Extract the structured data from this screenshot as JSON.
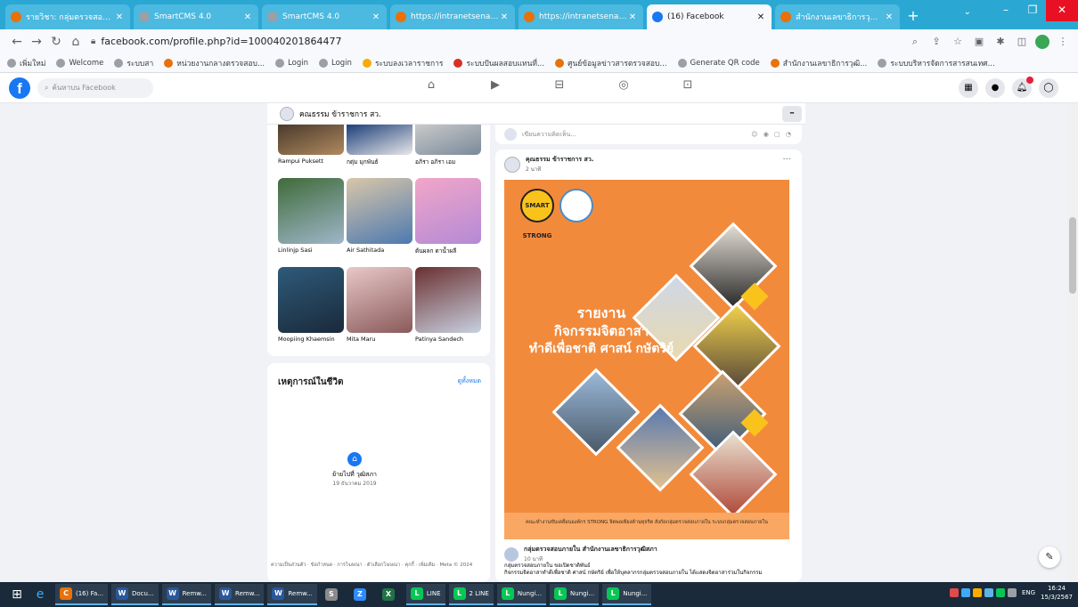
{
  "browser": {
    "tabs": [
      {
        "title": "รายวิชา: กลุ่มตรวจสอบภายใน",
        "color": "#e8710a",
        "active": false
      },
      {
        "title": "SmartCMS 4.0",
        "color": "#9aa0a6",
        "active": false
      },
      {
        "title": "SmartCMS 4.0",
        "color": "#9aa0a6",
        "active": false
      },
      {
        "title": "https://intranetsenate...",
        "color": "#e8710a",
        "active": false
      },
      {
        "title": "https://intranetsenate...",
        "color": "#e8710a",
        "active": false
      },
      {
        "title": "(16) Facebook",
        "color": "#1877f2",
        "active": true
      },
      {
        "title": "สำนักงานเลขาธิการวุฒิสภา",
        "color": "#e8710a",
        "active": false
      }
    ],
    "new_tab": "+",
    "url": "facebook.com/profile.php?id=100040201864477",
    "bookmarks": [
      {
        "label": "เพิ่มใหม่",
        "color": "#9aa0a6"
      },
      {
        "label": "Welcome",
        "color": "#9aa0a6"
      },
      {
        "label": "ระบบสา",
        "color": "#9aa0a6"
      },
      {
        "label": "หน่วยงานกลางตรวจสอบ...",
        "color": "#e8710a"
      },
      {
        "label": "Login",
        "color": "#9aa0a6"
      },
      {
        "label": "Login",
        "color": "#9aa0a6"
      },
      {
        "label": "ระบบลงเวลาราชการ",
        "color": "#f9ab00"
      },
      {
        "label": "ระบบปันผลสอบแทนที่...",
        "color": "#d93025"
      },
      {
        "label": "ศูนย์ข้อมูลข่าวสารตรวจสอบ...",
        "color": "#e8710a"
      },
      {
        "label": "Generate QR code",
        "color": "#9aa0a6"
      },
      {
        "label": "สำนักงานเลขาธิการวุฒิ...",
        "color": "#e8710a"
      },
      {
        "label": "ระบบบริหารจัดการสารสนเทศ...",
        "color": "#9aa0a6"
      }
    ]
  },
  "facebook": {
    "search_placeholder": "ค้นหาบน Facebook",
    "profile_name": "คณธรรม ข้าราชการ สว.",
    "friends": [
      {
        "name": "Rampui Puksett",
        "c1": "#4a3a2a",
        "c2": "#b08a60"
      },
      {
        "name": "กตุ่ม มุกพันธ์",
        "c1": "#1d3f7a",
        "c2": "#e8e8e8"
      },
      {
        "name": "อภิรา อภิรา เอม",
        "c1": "#c9c9c9",
        "c2": "#7a8a9a"
      },
      {
        "name": "Linlinjp Sasi",
        "c1": "#3f6b3a",
        "c2": "#9fb6c9"
      },
      {
        "name": "Air Sathitada",
        "c1": "#d9c6a9",
        "c2": "#4c7ab0"
      },
      {
        "name": "ต้นผลก ดาน้ำผลี",
        "c1": "#f2a6c8",
        "c2": "#b48ad6"
      },
      {
        "name": "Moopiing Khaemsin",
        "c1": "#2e5a7a",
        "c2": "#1a2a3a"
      },
      {
        "name": "Mita Maru",
        "c1": "#e9c8c8",
        "c2": "#8a5a5a"
      },
      {
        "name": "Patinya Sandech",
        "c1": "#6a3030",
        "c2": "#c8d0e0"
      }
    ],
    "events": {
      "title": "เหตุการณ์ในชีวิต",
      "see_all": "ดูทั้งหมด",
      "item_name": "ย้ายไปที่ วุฒิสภา",
      "item_date": "19 ธันวาคม 2019"
    },
    "footer": "ความเป็นส่วนตัว · ข้อกำหนด · การโฆษณา · ตัวเลือกโฆษณา · คุกกี้ · เพิ่มเติม · Meta © 2024",
    "comment_placeholder": "เขียนความคิดเห็น...",
    "post": {
      "author": "คุณธรรม ข้าราชการ สว.",
      "time": "2 นาที",
      "poster_title_1": "รายงาน",
      "poster_title_2": "กิจกรรมจิตอาสา",
      "poster_title_3": "ทำดีเพื่อชาติ ศาสน์ กษัตริย์",
      "poster_logo_1": "SMART STRONG",
      "poster_band": "คณะทำงานขับเคลื่อนองค์กร STRONG จิตพอเพียงต้านทุจริต สังกัดกลุ่มตรวจสอบภายใน ระบบกลุ่มตรวจสอบภายใน",
      "shared_from": "กลุ่มตรวจสอบภายใน สำนักงานเลขาธิการวุฒิสภา",
      "shared_time": "10 นาที",
      "shared_text_1": "กลุ่มตรวจสอบภายใน ขอเปิดชาติพันธ์",
      "shared_text_2": "กิจกรรมจิตอาสาทำดีเพื่อชาติ ศาสน์ กษัตริย์ เพื่อให้บุคลากรกลุ่มตรวจสอบภายใน ได้แสดงจิตอาสาร่วมในกิจกรรม"
    }
  },
  "taskbar": {
    "items": [
      {
        "label": "(16) Fa...",
        "icon": "C",
        "color": "#e8710a"
      },
      {
        "label": "Docu...",
        "icon": "W",
        "color": "#2b579a"
      },
      {
        "label": "Remw...",
        "icon": "W",
        "color": "#2b579a"
      },
      {
        "label": "Remw...",
        "icon": "W",
        "color": "#2b579a"
      },
      {
        "label": "Remw...",
        "icon": "W",
        "color": "#2b579a"
      },
      {
        "label": "",
        "icon": "S",
        "color": "#8a8a8a"
      },
      {
        "label": "",
        "icon": "Z",
        "color": "#2d8cff"
      },
      {
        "label": "",
        "icon": "X",
        "color": "#217346"
      },
      {
        "label": "LINE",
        "icon": "L",
        "color": "#06c755"
      },
      {
        "label": "2 LINE",
        "icon": "L",
        "color": "#06c755"
      },
      {
        "label": "Nungi...",
        "icon": "L",
        "color": "#06c755"
      },
      {
        "label": "Nungi...",
        "icon": "L",
        "color": "#06c755"
      },
      {
        "label": "Nungi...",
        "icon": "L",
        "color": "#06c755"
      }
    ],
    "lang": "ENG",
    "time": "16:24",
    "date": "15/3/2567"
  }
}
